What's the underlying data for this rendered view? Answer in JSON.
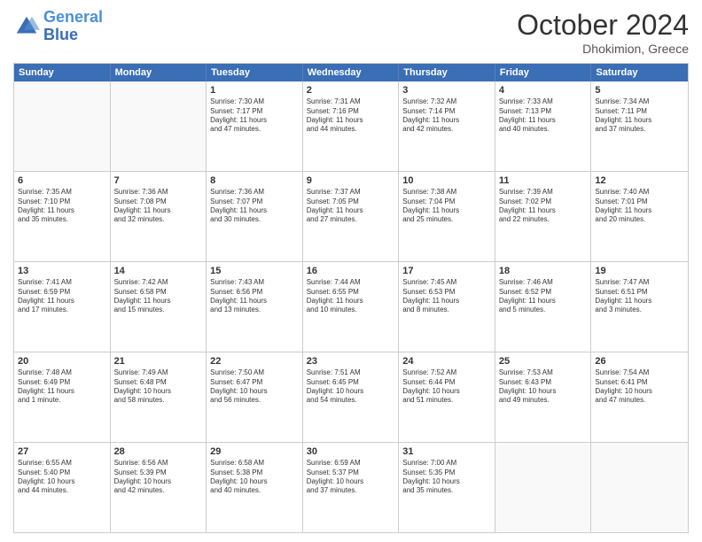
{
  "logo": {
    "line1": "General",
    "line2": "Blue"
  },
  "title": "October 2024",
  "location": "Dhokimion, Greece",
  "weekdays": [
    "Sunday",
    "Monday",
    "Tuesday",
    "Wednesday",
    "Thursday",
    "Friday",
    "Saturday"
  ],
  "rows": [
    [
      {
        "day": "",
        "empty": true
      },
      {
        "day": "",
        "empty": true
      },
      {
        "day": "1",
        "line1": "Sunrise: 7:30 AM",
        "line2": "Sunset: 7:17 PM",
        "line3": "Daylight: 11 hours",
        "line4": "and 47 minutes."
      },
      {
        "day": "2",
        "line1": "Sunrise: 7:31 AM",
        "line2": "Sunset: 7:16 PM",
        "line3": "Daylight: 11 hours",
        "line4": "and 44 minutes."
      },
      {
        "day": "3",
        "line1": "Sunrise: 7:32 AM",
        "line2": "Sunset: 7:14 PM",
        "line3": "Daylight: 11 hours",
        "line4": "and 42 minutes."
      },
      {
        "day": "4",
        "line1": "Sunrise: 7:33 AM",
        "line2": "Sunset: 7:13 PM",
        "line3": "Daylight: 11 hours",
        "line4": "and 40 minutes."
      },
      {
        "day": "5",
        "line1": "Sunrise: 7:34 AM",
        "line2": "Sunset: 7:11 PM",
        "line3": "Daylight: 11 hours",
        "line4": "and 37 minutes."
      }
    ],
    [
      {
        "day": "6",
        "line1": "Sunrise: 7:35 AM",
        "line2": "Sunset: 7:10 PM",
        "line3": "Daylight: 11 hours",
        "line4": "and 35 minutes."
      },
      {
        "day": "7",
        "line1": "Sunrise: 7:36 AM",
        "line2": "Sunset: 7:08 PM",
        "line3": "Daylight: 11 hours",
        "line4": "and 32 minutes."
      },
      {
        "day": "8",
        "line1": "Sunrise: 7:36 AM",
        "line2": "Sunset: 7:07 PM",
        "line3": "Daylight: 11 hours",
        "line4": "and 30 minutes."
      },
      {
        "day": "9",
        "line1": "Sunrise: 7:37 AM",
        "line2": "Sunset: 7:05 PM",
        "line3": "Daylight: 11 hours",
        "line4": "and 27 minutes."
      },
      {
        "day": "10",
        "line1": "Sunrise: 7:38 AM",
        "line2": "Sunset: 7:04 PM",
        "line3": "Daylight: 11 hours",
        "line4": "and 25 minutes."
      },
      {
        "day": "11",
        "line1": "Sunrise: 7:39 AM",
        "line2": "Sunset: 7:02 PM",
        "line3": "Daylight: 11 hours",
        "line4": "and 22 minutes."
      },
      {
        "day": "12",
        "line1": "Sunrise: 7:40 AM",
        "line2": "Sunset: 7:01 PM",
        "line3": "Daylight: 11 hours",
        "line4": "and 20 minutes."
      }
    ],
    [
      {
        "day": "13",
        "line1": "Sunrise: 7:41 AM",
        "line2": "Sunset: 6:59 PM",
        "line3": "Daylight: 11 hours",
        "line4": "and 17 minutes."
      },
      {
        "day": "14",
        "line1": "Sunrise: 7:42 AM",
        "line2": "Sunset: 6:58 PM",
        "line3": "Daylight: 11 hours",
        "line4": "and 15 minutes."
      },
      {
        "day": "15",
        "line1": "Sunrise: 7:43 AM",
        "line2": "Sunset: 6:56 PM",
        "line3": "Daylight: 11 hours",
        "line4": "and 13 minutes."
      },
      {
        "day": "16",
        "line1": "Sunrise: 7:44 AM",
        "line2": "Sunset: 6:55 PM",
        "line3": "Daylight: 11 hours",
        "line4": "and 10 minutes."
      },
      {
        "day": "17",
        "line1": "Sunrise: 7:45 AM",
        "line2": "Sunset: 6:53 PM",
        "line3": "Daylight: 11 hours",
        "line4": "and 8 minutes."
      },
      {
        "day": "18",
        "line1": "Sunrise: 7:46 AM",
        "line2": "Sunset: 6:52 PM",
        "line3": "Daylight: 11 hours",
        "line4": "and 5 minutes."
      },
      {
        "day": "19",
        "line1": "Sunrise: 7:47 AM",
        "line2": "Sunset: 6:51 PM",
        "line3": "Daylight: 11 hours",
        "line4": "and 3 minutes."
      }
    ],
    [
      {
        "day": "20",
        "line1": "Sunrise: 7:48 AM",
        "line2": "Sunset: 6:49 PM",
        "line3": "Daylight: 11 hours",
        "line4": "and 1 minute."
      },
      {
        "day": "21",
        "line1": "Sunrise: 7:49 AM",
        "line2": "Sunset: 6:48 PM",
        "line3": "Daylight: 10 hours",
        "line4": "and 58 minutes."
      },
      {
        "day": "22",
        "line1": "Sunrise: 7:50 AM",
        "line2": "Sunset: 6:47 PM",
        "line3": "Daylight: 10 hours",
        "line4": "and 56 minutes."
      },
      {
        "day": "23",
        "line1": "Sunrise: 7:51 AM",
        "line2": "Sunset: 6:45 PM",
        "line3": "Daylight: 10 hours",
        "line4": "and 54 minutes."
      },
      {
        "day": "24",
        "line1": "Sunrise: 7:52 AM",
        "line2": "Sunset: 6:44 PM",
        "line3": "Daylight: 10 hours",
        "line4": "and 51 minutes."
      },
      {
        "day": "25",
        "line1": "Sunrise: 7:53 AM",
        "line2": "Sunset: 6:43 PM",
        "line3": "Daylight: 10 hours",
        "line4": "and 49 minutes."
      },
      {
        "day": "26",
        "line1": "Sunrise: 7:54 AM",
        "line2": "Sunset: 6:41 PM",
        "line3": "Daylight: 10 hours",
        "line4": "and 47 minutes."
      }
    ],
    [
      {
        "day": "27",
        "line1": "Sunrise: 6:55 AM",
        "line2": "Sunset: 5:40 PM",
        "line3": "Daylight: 10 hours",
        "line4": "and 44 minutes."
      },
      {
        "day": "28",
        "line1": "Sunrise: 6:56 AM",
        "line2": "Sunset: 5:39 PM",
        "line3": "Daylight: 10 hours",
        "line4": "and 42 minutes."
      },
      {
        "day": "29",
        "line1": "Sunrise: 6:58 AM",
        "line2": "Sunset: 5:38 PM",
        "line3": "Daylight: 10 hours",
        "line4": "and 40 minutes."
      },
      {
        "day": "30",
        "line1": "Sunrise: 6:59 AM",
        "line2": "Sunset: 5:37 PM",
        "line3": "Daylight: 10 hours",
        "line4": "and 37 minutes."
      },
      {
        "day": "31",
        "line1": "Sunrise: 7:00 AM",
        "line2": "Sunset: 5:35 PM",
        "line3": "Daylight: 10 hours",
        "line4": "and 35 minutes."
      },
      {
        "day": "",
        "empty": true
      },
      {
        "day": "",
        "empty": true
      }
    ]
  ]
}
